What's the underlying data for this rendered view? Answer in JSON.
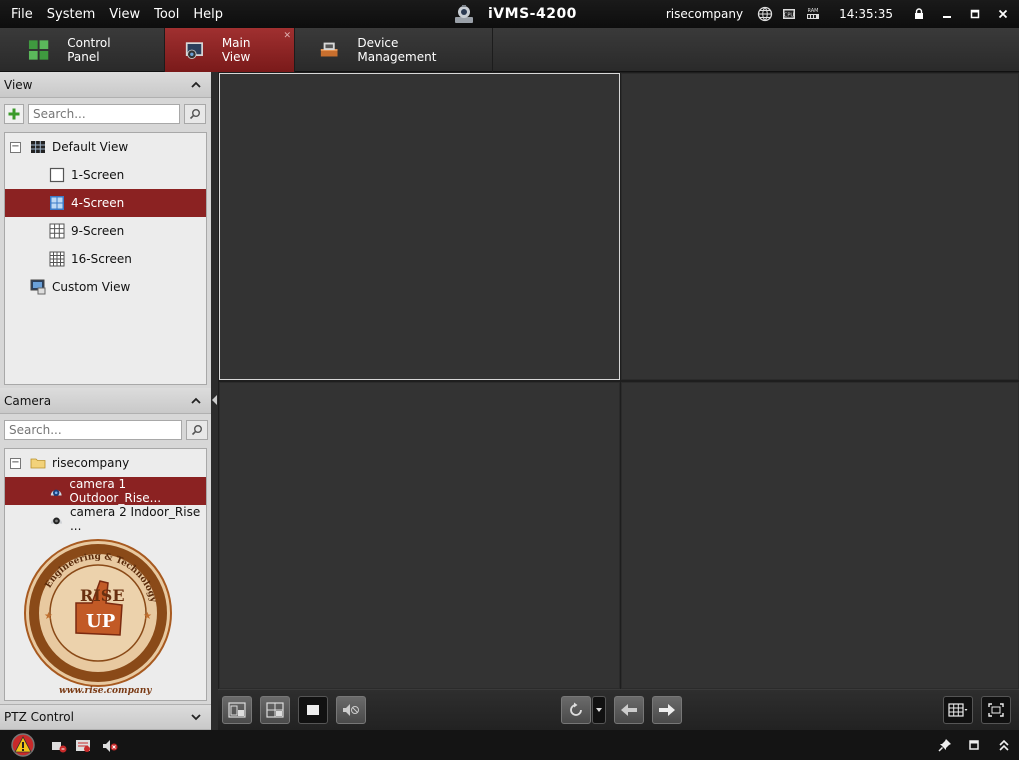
{
  "menu": [
    "File",
    "System",
    "View",
    "Tool",
    "Help"
  ],
  "app_title": "iVMS-4200",
  "user": "risecompany",
  "clock": "14:35:35",
  "status_icons": [
    "network-icon",
    "cpu-icon",
    "ram-icon"
  ],
  "ram_label": "RAM",
  "cpu_label": "CPU",
  "tabs": [
    {
      "label": "Control Panel",
      "icon": "control-panel-icon",
      "active": false
    },
    {
      "label": "Main View",
      "icon": "main-view-icon",
      "active": true
    },
    {
      "label": "Device Management",
      "icon": "device-management-icon",
      "active": false
    }
  ],
  "view_panel": {
    "title": "View",
    "search_placeholder": "Search...",
    "items": [
      {
        "label": "Default View",
        "icon": "grid-view-icon",
        "level": 0,
        "expander": "−",
        "selected": false
      },
      {
        "label": "1-Screen",
        "icon": "one-screen-icon",
        "level": 1,
        "selected": false
      },
      {
        "label": "4-Screen",
        "icon": "four-screen-icon",
        "level": 1,
        "selected": true
      },
      {
        "label": "9-Screen",
        "icon": "nine-screen-icon",
        "level": 1,
        "selected": false
      },
      {
        "label": "16-Screen",
        "icon": "sixteen-screen-icon",
        "level": 1,
        "selected": false
      },
      {
        "label": "Custom View",
        "icon": "custom-view-icon",
        "level": 0,
        "selected": false
      }
    ]
  },
  "camera_panel": {
    "title": "Camera",
    "search_placeholder": "Search...",
    "items": [
      {
        "label": "risecompany",
        "icon": "folder-icon",
        "level": 0,
        "expander": "−",
        "selected": false
      },
      {
        "label": "camera 1 Outdoor_Rise...",
        "icon": "camera-icon",
        "level": 1,
        "selected": true
      },
      {
        "label": "camera 2 Indoor_Rise ...",
        "icon": "camera-icon",
        "level": 1,
        "selected": false
      }
    ],
    "watermark_url": "www.rise.company",
    "watermark_text": [
      "RISE",
      "UP",
      "Engineering & Technology"
    ]
  },
  "ptz_panel": {
    "title": "PTZ Control"
  },
  "colors": {
    "accent": "#8b2222",
    "tab_active": "#a03030",
    "pane": "#333333",
    "background": "#1b1b1b"
  }
}
